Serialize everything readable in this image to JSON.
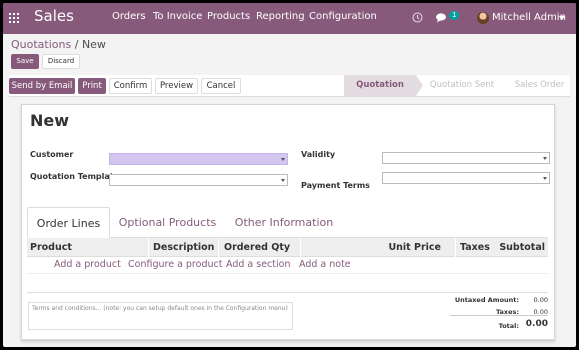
{
  "navbar": {
    "app_title": "Sales",
    "menu": [
      "Orders",
      "To Invoice",
      "Products",
      "Reporting",
      "Configuration"
    ],
    "messages_badge": "1",
    "user_name": "Mitchell Admin"
  },
  "breadcrumb": {
    "parent": "Quotations",
    "separator": "/",
    "current": "New"
  },
  "control": {
    "save_label": "Save",
    "discard_label": "Discard"
  },
  "header": {
    "buttons": [
      "Send by Email",
      "Print",
      "Confirm",
      "Preview",
      "Cancel"
    ],
    "status_steps": [
      "Quotation",
      "Quotation Sent",
      "Sales Order"
    ],
    "active_status": "Quotation"
  },
  "form": {
    "title": "New",
    "customer_label": "Customer",
    "customer_value": "",
    "template_label": "Quotation Template",
    "template_value": "",
    "validity_label": "Validity",
    "validity_value": "",
    "payment_terms_label": "Payment Terms",
    "payment_terms_value": ""
  },
  "tabs": [
    "Order Lines",
    "Optional Products",
    "Other Information"
  ],
  "table": {
    "columns": [
      "Product",
      "Description",
      "Ordered Qty",
      "Unit Price",
      "Taxes",
      "Subtotal"
    ],
    "actions": [
      "Add a product",
      "Configure a product",
      "Add a section",
      "Add a note"
    ]
  },
  "notes_placeholder": "Terms and conditions... (note: you can setup default ones in the Configuration menu)",
  "totals": {
    "untaxed_label": "Untaxed Amount:",
    "untaxed_value": "0.00",
    "taxes_label": "Taxes:",
    "taxes_value": "0.00",
    "total_label": "Total:",
    "total_value": "0.00"
  },
  "colors": {
    "brand": "#875a7b",
    "required_field": "#d2c5f0",
    "badge": "#00a09d"
  }
}
